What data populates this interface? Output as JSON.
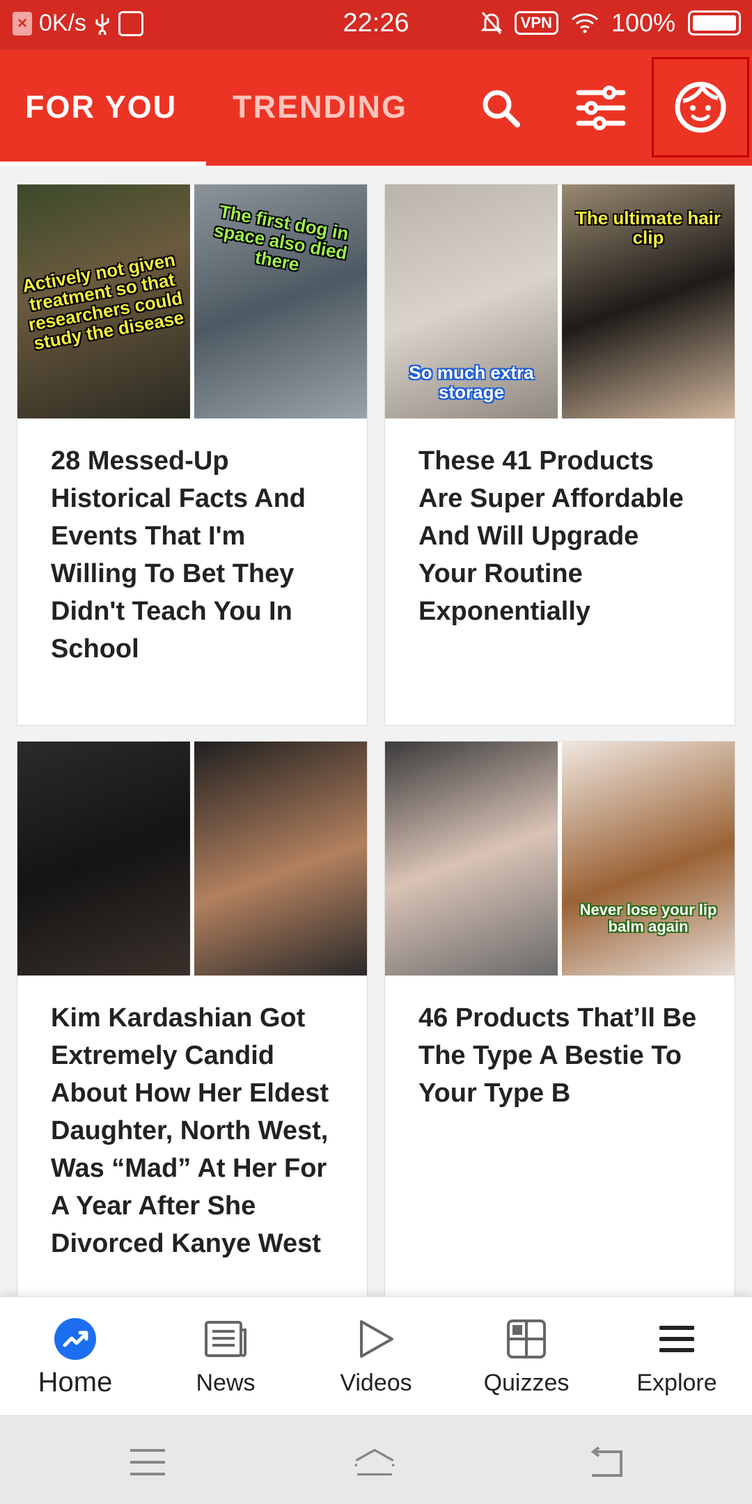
{
  "status_bar": {
    "net_speed": "0K/s",
    "time": "22:26",
    "vpn": "VPN",
    "battery": "100%"
  },
  "top_bar": {
    "tabs": [
      "FOR YOU",
      "TRENDING"
    ],
    "active_tab": "FOR YOU",
    "icons": [
      "search-icon",
      "filter-icon",
      "profile-icon"
    ]
  },
  "feed": {
    "cards": [
      {
        "title": "28 Messed-Up Historical Facts And Events That I'm Willing To Bet They Didn't Teach You In School",
        "captions": [
          "Actively not given treatment so that researchers could study the disease",
          "The first dog in space also died there"
        ]
      },
      {
        "title": "These 41 Products Are Super Affordable And Will Upgrade Your Routine Exponentially",
        "captions": [
          "So much extra storage",
          "The ultimate hair clip"
        ]
      },
      {
        "title": "Kim Kardashian Got Extremely Candid About How Her Eldest Daughter, North West, Was “Mad” At Her For A Year After She Divorced Kanye West",
        "captions": []
      },
      {
        "title": "46 Products That’ll Be The Type A Bestie To Your Type B",
        "captions": [
          "Never lose your lip balm again"
        ]
      }
    ]
  },
  "bottom_nav": {
    "items": [
      {
        "label": "Home",
        "icon": "trending-up-icon",
        "active": true
      },
      {
        "label": "News",
        "icon": "news-icon",
        "active": false
      },
      {
        "label": "Videos",
        "icon": "play-icon",
        "active": false
      },
      {
        "label": "Quizzes",
        "icon": "grid-icon",
        "active": false
      },
      {
        "label": "Explore",
        "icon": "menu-icon",
        "active": false
      }
    ]
  },
  "colors": {
    "brand_red": "#ec3424",
    "status_red": "#d42a22",
    "home_blue": "#1b6ef0"
  }
}
